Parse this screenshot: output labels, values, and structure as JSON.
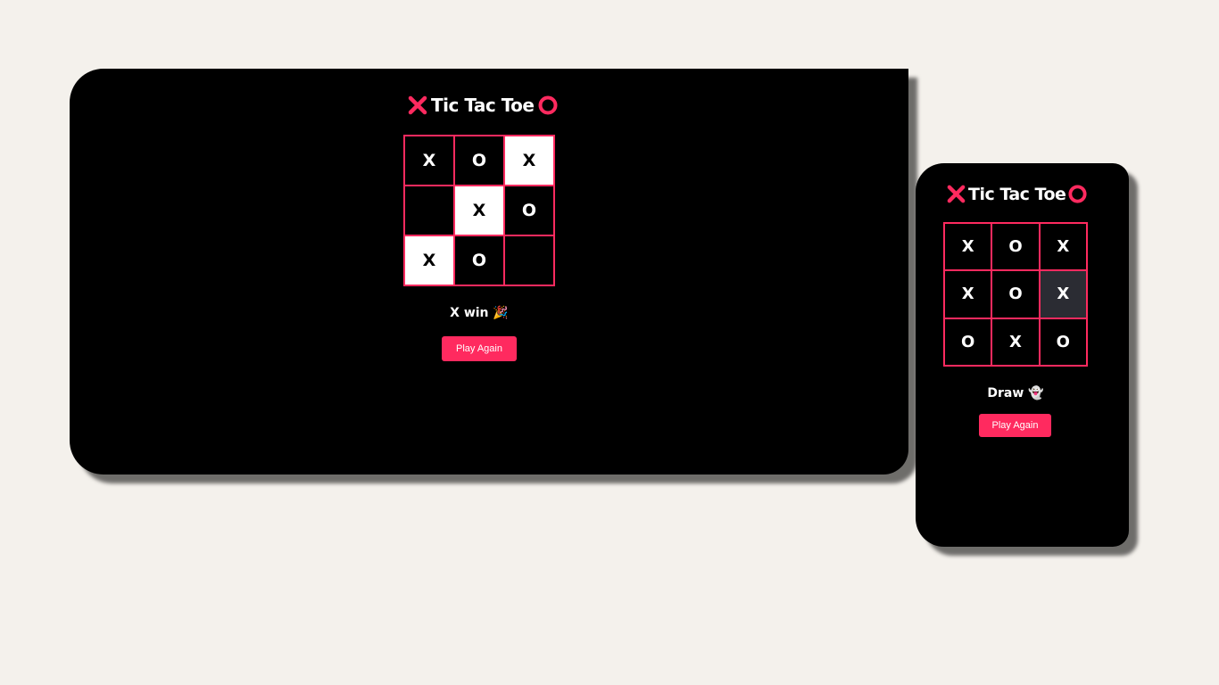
{
  "accent_color": "#ff2a5f",
  "desktop": {
    "title": "Tic Tac Toe",
    "title_left_icon": "x-icon",
    "title_right_icon": "o-icon",
    "board": [
      [
        "X",
        "O",
        "X"
      ],
      [
        "",
        "X",
        "O"
      ],
      [
        "X",
        "O",
        ""
      ]
    ],
    "status": "X win 🎉",
    "button_label": "Play Again"
  },
  "mobile": {
    "title": "Tic Tac Toe",
    "title_left_icon": "x-icon",
    "title_right_icon": "o-icon",
    "board": [
      [
        "X",
        "O",
        "X"
      ],
      [
        "X",
        "O",
        "X"
      ],
      [
        "O",
        "X",
        "O"
      ]
    ],
    "status": "Draw 👻",
    "button_label": "Play Again"
  }
}
